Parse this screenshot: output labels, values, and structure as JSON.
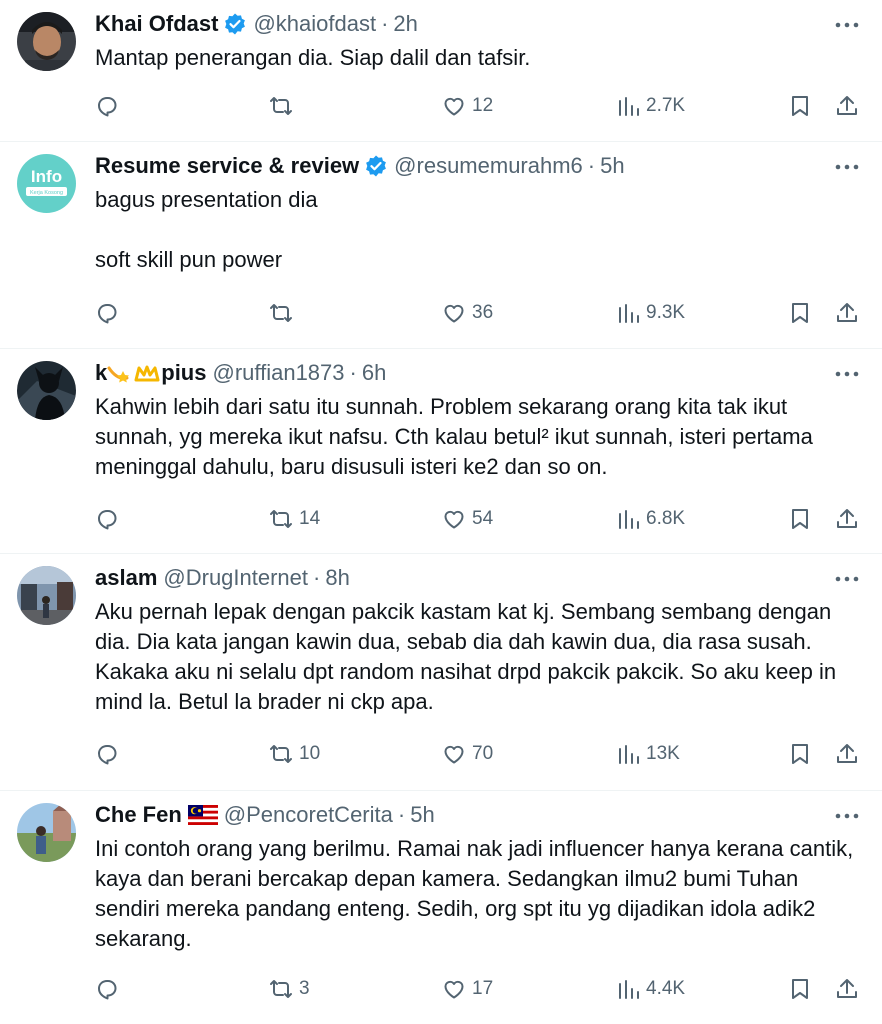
{
  "tweets": [
    {
      "name": "Khai Ofdast",
      "verified": true,
      "handle": "@khaiofdast",
      "time": "2h",
      "text": "Mantap penerangan dia. Siap dalil dan tafsir.",
      "replies": "",
      "retweets": "",
      "likes": "12",
      "views": "2.7K"
    },
    {
      "name": "Resume service & review",
      "verified": true,
      "handle": "@resumemurahm6",
      "time": "5h",
      "text": "bagus presentation dia\n\nsoft skill pun power",
      "replies": "",
      "retweets": "",
      "likes": "36",
      "views": "9.3K",
      "avatar_text": "Info",
      "avatar_subtext": "Kerja Kosong"
    },
    {
      "name_prefix": "k",
      "name_suffix": "pius",
      "verified": false,
      "handle": "@ruffian1873",
      "time": "6h",
      "text": "Kahwin lebih dari satu itu sunnah. Problem sekarang orang kita tak ikut sunnah, yg mereka ikut nafsu. Cth kalau betul² ikut sunnah, isteri pertama meninggal dahulu, baru disusuli isteri ke2 dan so on.",
      "replies": "",
      "retweets": "14",
      "likes": "54",
      "views": "6.8K"
    },
    {
      "name": "aslam",
      "verified": false,
      "handle": "@DrugInternet",
      "time": "8h",
      "text": "Aku pernah lepak dengan pakcik kastam kat kj. Sembang sembang dengan dia. Dia kata jangan kawin dua, sebab dia dah kawin dua, dia rasa susah. Kakaka aku ni selalu dpt random nasihat drpd pakcik pakcik. So aku keep in mind la. Betul la brader ni ckp apa.",
      "replies": "",
      "retweets": "10",
      "likes": "70",
      "views": "13K"
    },
    {
      "name": "Che Fen",
      "verified": false,
      "handle": "@PencoretCerita",
      "time": "5h",
      "text": "Ini contoh orang yang berilmu. Ramai nak jadi influencer hanya kerana cantik, kaya dan berani bercakap depan kamera. Sedangkan ilmu2 bumi Tuhan sendiri mereka pandang enteng. Sedih, org spt itu yg dijadikan idola adik2 sekarang.",
      "replies": "",
      "retweets": "3",
      "likes": "17",
      "views": "4.4K"
    }
  ],
  "colors": {
    "text": "#0f1419",
    "secondary": "#536471",
    "verified": "#1d9bf0",
    "divider": "#eff3f4"
  },
  "icons": [
    "reply-icon",
    "retweet-icon",
    "like-icon",
    "views-icon",
    "bookmark-icon",
    "share-icon",
    "more-icon",
    "verified-badge-icon"
  ]
}
